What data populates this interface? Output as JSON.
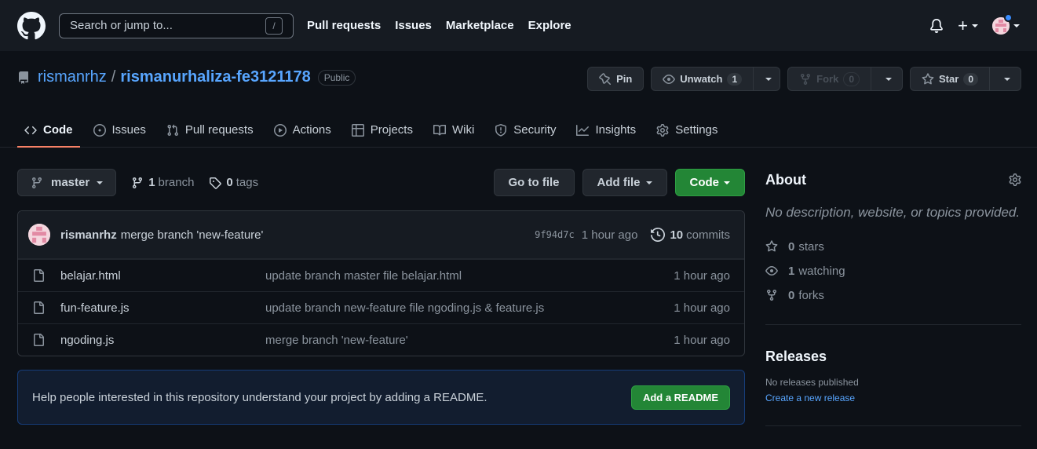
{
  "header": {
    "search_placeholder": "Search or jump to...",
    "search_shortcut": "/",
    "nav": [
      "Pull requests",
      "Issues",
      "Marketplace",
      "Explore"
    ],
    "plus_label": "+"
  },
  "repo": {
    "owner": "rismanrhz",
    "separator": "/",
    "name": "rismanurhaliza-fe3121178",
    "visibility": "Public",
    "pin_label": "Pin",
    "unwatch_label": "Unwatch",
    "unwatch_count": "1",
    "fork_label": "Fork",
    "fork_count": "0",
    "star_label": "Star",
    "star_count": "0"
  },
  "tabs": [
    {
      "label": "Code",
      "icon": "code-icon"
    },
    {
      "label": "Issues",
      "icon": "issue-icon"
    },
    {
      "label": "Pull requests",
      "icon": "pull-request-icon"
    },
    {
      "label": "Actions",
      "icon": "play-icon"
    },
    {
      "label": "Projects",
      "icon": "table-icon"
    },
    {
      "label": "Wiki",
      "icon": "book-icon"
    },
    {
      "label": "Security",
      "icon": "shield-icon"
    },
    {
      "label": "Insights",
      "icon": "graph-icon"
    },
    {
      "label": "Settings",
      "icon": "gear-icon"
    }
  ],
  "toolbar": {
    "branch": "master",
    "branch_count": "1",
    "branch_word": "branch",
    "tag_count": "0",
    "tag_word": "tags",
    "goto_label": "Go to file",
    "addfile_label": "Add file",
    "code_label": "Code"
  },
  "commit": {
    "author": "rismanrhz",
    "message": "merge branch 'new-feature'",
    "sha": "9f94d7c",
    "time": "1 hour ago",
    "commit_count": "10",
    "commit_word": "commits"
  },
  "files": [
    {
      "name": "belajar.html",
      "message": "update branch master file belajar.html",
      "time": "1 hour ago"
    },
    {
      "name": "fun-feature.js",
      "message": "update branch new-feature file ngoding.js & feature.js",
      "time": "1 hour ago"
    },
    {
      "name": "ngoding.js",
      "message": "merge branch 'new-feature'",
      "time": "1 hour ago"
    }
  ],
  "readme": {
    "text": "Help people interested in this repository understand your project by adding a README.",
    "button": "Add a README"
  },
  "about": {
    "title": "About",
    "description": "No description, website, or topics provided.",
    "stars_count": "0",
    "stars_word": "stars",
    "watching_count": "1",
    "watching_word": "watching",
    "forks_count": "0",
    "forks_word": "forks"
  },
  "releases": {
    "title": "Releases",
    "none": "No releases published",
    "create_link": "Create a new release"
  },
  "colors": {
    "background": "#0d1117",
    "header": "#161b22",
    "link": "#58a6ff",
    "green": "#238636",
    "tab_underline": "#f78166"
  }
}
